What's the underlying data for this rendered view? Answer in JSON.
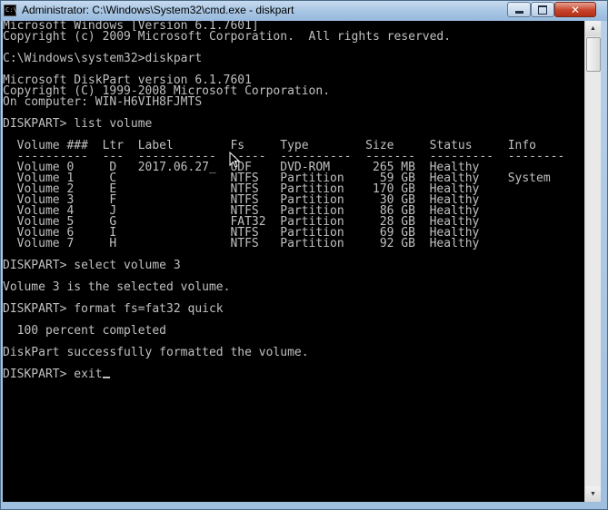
{
  "window": {
    "title": "Administrator: C:\\Windows\\System32\\cmd.exe - diskpart",
    "icon_text": "C:\\",
    "minimize_icon": "minimize-icon",
    "maximize_icon": "maximize-icon",
    "close_glyph": "✕"
  },
  "console": {
    "lines": [
      "Microsoft Windows [Version 6.1.7601]",
      "Copyright (c) 2009 Microsoft Corporation.  All rights reserved.",
      "",
      "C:\\Windows\\system32>diskpart",
      "",
      "Microsoft DiskPart version 6.1.7601",
      "Copyright (C) 1999-2008 Microsoft Corporation.",
      "On computer: WIN-H6VIH8FJMTS",
      "",
      "DISKPART> list volume",
      "",
      "  Volume ###  Ltr  Label        Fs     Type        Size     Status     Info",
      "  ----------  ---  -----------  -----  ----------  -------  ---------  --------",
      "  Volume 0     D   2017.06.27_  UDF    DVD-ROM      265 MB  Healthy",
      "  Volume 1     C                NTFS   Partition     59 GB  Healthy    System",
      "  Volume 2     E                NTFS   Partition    170 GB  Healthy",
      "  Volume 3     F                NTFS   Partition     30 GB  Healthy",
      "  Volume 4     J                NTFS   Partition     86 GB  Healthy",
      "  Volume 5     G                FAT32  Partition     28 GB  Healthy",
      "  Volume 6     I                NTFS   Partition     69 GB  Healthy",
      "  Volume 7     H                NTFS   Partition     92 GB  Healthy",
      "",
      "DISKPART> select volume 3",
      "",
      "Volume 3 is the selected volume.",
      "",
      "DISKPART> format fs=fat32 quick",
      "",
      "  100 percent completed",
      "",
      "DiskPart successfully formatted the volume.",
      "",
      "DISKPART> exit"
    ]
  },
  "scrollbar": {
    "up_glyph": "▲",
    "down_glyph": "▼"
  }
}
